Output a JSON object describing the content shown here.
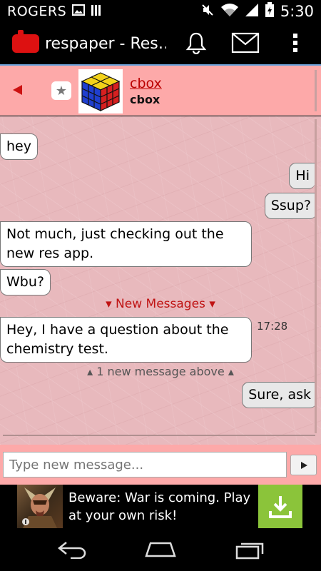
{
  "status_bar": {
    "carrier": "ROGERS",
    "time": "5:30",
    "icons": [
      "image-icon",
      "signal-bars-icon",
      "mute-icon",
      "wifi-icon",
      "cell-signal-icon",
      "battery-icon"
    ]
  },
  "action_bar": {
    "title": "respaper - Res…",
    "icons": [
      "app-logo",
      "bell-icon",
      "mail-icon",
      "overflow-menu-icon"
    ]
  },
  "conversation": {
    "contact_name": "cbox",
    "contact_subtitle": "cbox"
  },
  "messages": [
    {
      "direction": "in",
      "text": "hey"
    },
    {
      "direction": "out",
      "text": "Hi"
    },
    {
      "direction": "out",
      "text": "Ssup?"
    },
    {
      "direction": "in",
      "text": "Not much, just checking out the new res app."
    },
    {
      "direction": "in",
      "text": "Wbu?"
    },
    {
      "direction": "in",
      "text": "Hey, I have a question about the chemistry test.",
      "time": "17:28"
    },
    {
      "direction": "out",
      "text": "Sure, ask"
    }
  ],
  "dividers": {
    "new_messages": "▾ New Messages ▾",
    "new_above": "▴ 1 new message above ▴"
  },
  "composer": {
    "placeholder": "Type new message..."
  },
  "ad": {
    "text": "Beware: War is coming. Play at your own risk!"
  },
  "colors": {
    "header_bg": "#fda9a9",
    "chat_bg": "#e8b9bd",
    "accent_red": "#cc1111",
    "ad_download": "#8bc43a"
  }
}
